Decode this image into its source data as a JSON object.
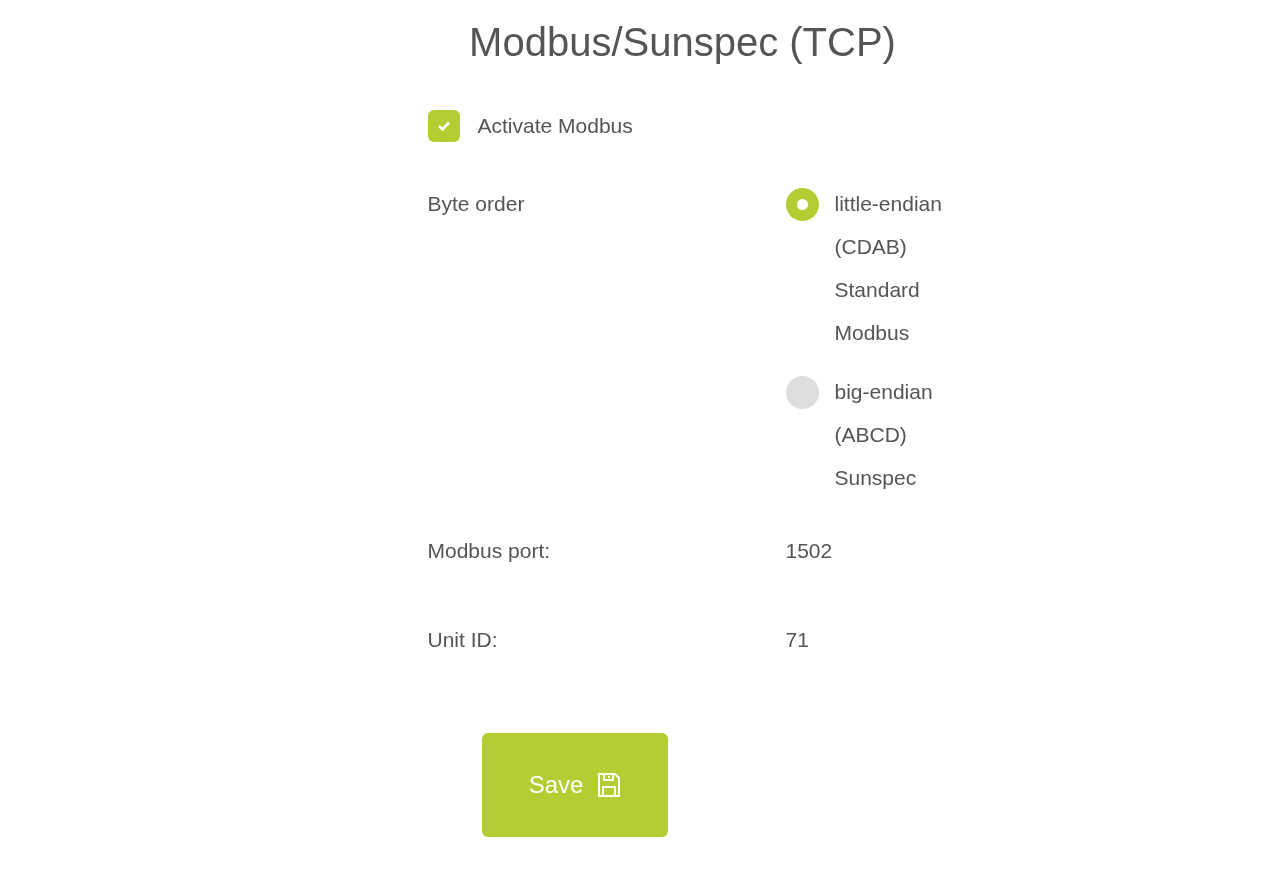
{
  "title": "Modbus/Sunspec (TCP)",
  "activate": {
    "label": "Activate Modbus",
    "checked": true
  },
  "byte_order": {
    "label": "Byte order",
    "options": [
      {
        "label": "little-endian (CDAB) Standard Modbus",
        "selected": true
      },
      {
        "label": "big-endian (ABCD) Sunspec",
        "selected": false
      }
    ]
  },
  "fields": [
    {
      "label": "Modbus port:",
      "value": "1502"
    },
    {
      "label": "Unit ID:",
      "value": "71"
    }
  ],
  "save_button": {
    "label": "Save"
  }
}
